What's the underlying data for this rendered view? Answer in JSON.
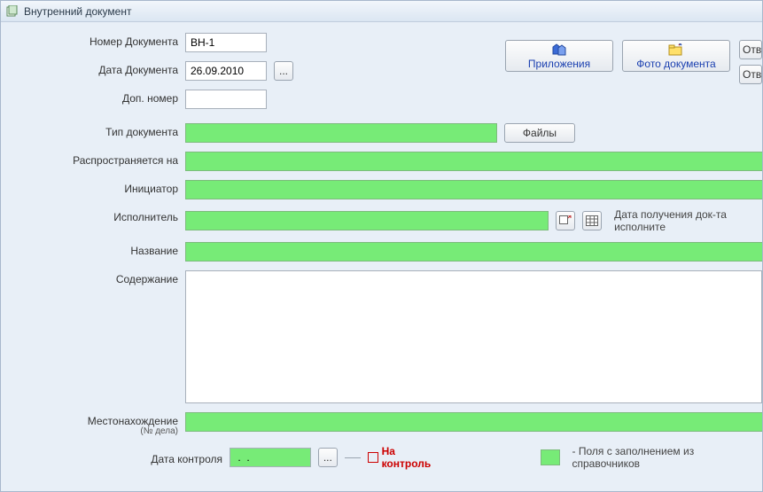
{
  "window": {
    "title": "Внутренний документ"
  },
  "labels": {
    "doc_number": "Номер Документа",
    "doc_date": "Дата Документа",
    "dop_number": "Доп. номер",
    "doc_type": "Тип документа",
    "applies_to": "Распространяется на",
    "initiator": "Инициатор",
    "executor": "Исполнитель",
    "executor_date": "Дата получения док-та исполните",
    "title": "Название",
    "content": "Содержание",
    "location": "Местонахождение",
    "location_sub": "(№ дела)",
    "control_date": "Дата контроля",
    "on_control": "На контроль",
    "legend": "- Поля с заполнением из справочников"
  },
  "buttons": {
    "attachments": "Приложения",
    "photo": "Фото документа",
    "files": "Файлы",
    "resp1": "Отве",
    "resp2": "Отве"
  },
  "fields": {
    "doc_number": "ВН-1",
    "doc_date": "26.09.2010",
    "dop_number": "",
    "doc_type": "",
    "applies_to": "",
    "initiator": "",
    "executor": "",
    "title": "",
    "content": "",
    "location": "",
    "control_date": " .  ."
  }
}
